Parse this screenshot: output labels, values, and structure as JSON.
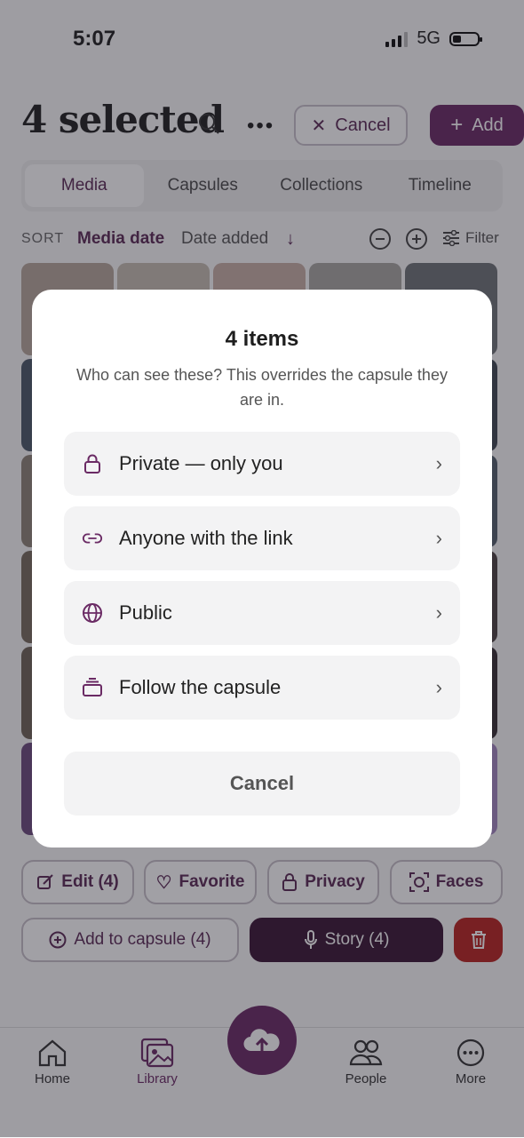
{
  "status": {
    "time": "5:07",
    "network": "5G"
  },
  "header": {
    "title": "4 selected",
    "cancel_label": "Cancel",
    "add_label": "Add"
  },
  "tabs": [
    {
      "label": "Media"
    },
    {
      "label": "Capsules"
    },
    {
      "label": "Collections"
    },
    {
      "label": "Timeline"
    }
  ],
  "sort": {
    "label": "SORT",
    "media_date": "Media date",
    "date_added": "Date added",
    "filter": "Filter"
  },
  "actions": {
    "edit": "Edit (4)",
    "favorite": "Favorite",
    "privacy": "Privacy",
    "faces": "Faces",
    "add_to_capsule": "Add to capsule (4)",
    "story": "Story (4)"
  },
  "tabbar": {
    "home": "Home",
    "library": "Library",
    "people": "People",
    "more": "More"
  },
  "modal": {
    "title": "4 items",
    "subtitle": "Who can see these? This overrides the capsule they are in.",
    "options": [
      {
        "label": "Private — only you",
        "icon": "lock-icon"
      },
      {
        "label": "Anyone with the link",
        "icon": "link-icon"
      },
      {
        "label": "Public",
        "icon": "globe-icon"
      },
      {
        "label": "Follow the capsule",
        "icon": "stack-icon"
      }
    ],
    "cancel_label": "Cancel"
  },
  "colors": {
    "accent": "#6a2a64",
    "danger": "#b8231f",
    "story_bg": "#3a1535"
  }
}
